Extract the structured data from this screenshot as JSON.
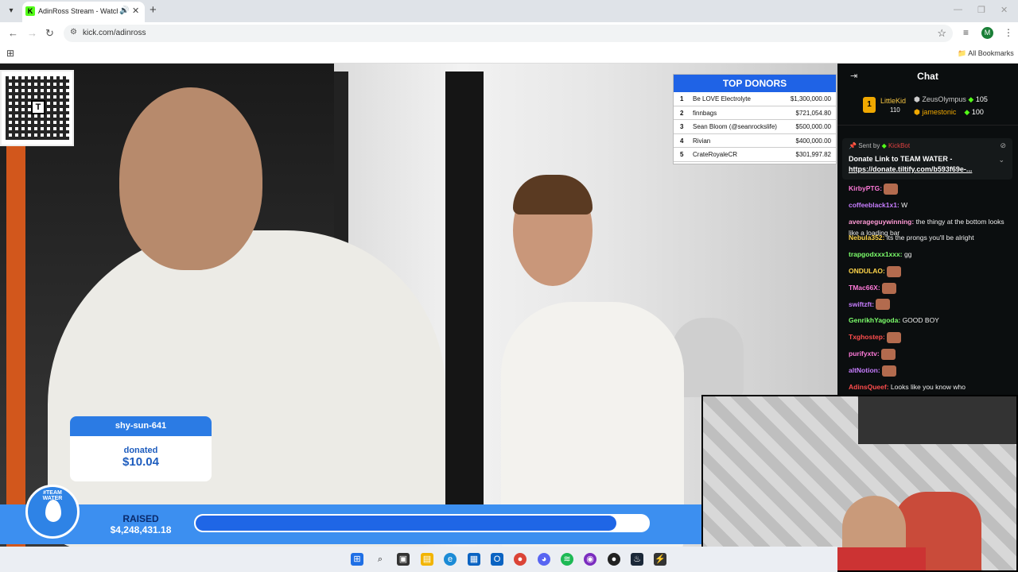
{
  "browser": {
    "tab_title": "AdinRoss Stream - Watch Live",
    "url": "kick.com/adinross",
    "all_bookmarks": "All Bookmarks",
    "profile_initial": "M"
  },
  "stream": {
    "qr_center": "T",
    "top_donors": {
      "title": "TOP DONORS",
      "rows": [
        {
          "rank": "1",
          "name": "Be LOVE Electrolyte",
          "amount": "$1,300,000.00"
        },
        {
          "rank": "2",
          "name": "finnbags",
          "amount": "$721,054.80"
        },
        {
          "rank": "3",
          "name": "Sean Bloom (@seanrockslife)",
          "amount": "$500,000.00"
        },
        {
          "rank": "4",
          "name": "Rivian",
          "amount": "$400,000.00"
        },
        {
          "rank": "5",
          "name": "CrateRoyaleCR",
          "amount": "$301,997.82"
        }
      ]
    },
    "alert": {
      "username": "shy-sun-641",
      "label": "donated",
      "amount": "$10.04"
    },
    "raised": {
      "label": "RAISED",
      "amount": "$4,248,431.18",
      "progress_fraction": 0.93
    },
    "logo_text": "#TEAM WATER"
  },
  "chat": {
    "title": "Chat",
    "leaderboard": {
      "first": {
        "rank": "1",
        "name": "LittleKid",
        "count": "110"
      },
      "second": {
        "name": "ZeusOlympus",
        "count": "105"
      },
      "third": {
        "name": "jamestonic",
        "count": "100"
      }
    },
    "pinned": {
      "sent_by": "Sent by",
      "sender": "KickBot",
      "title": "Donate Link to TEAM WATER -",
      "link": "https://donate.tiltify.com/b593f69e-..."
    },
    "messages": [
      {
        "user": "KirbyPTG:",
        "text": "",
        "color": "#ff7ad9",
        "emote": true
      },
      {
        "user": "coffeeblack1x1:",
        "text": "W",
        "color": "#c77dff",
        "emote": false
      },
      {
        "user": "averageguywinning:",
        "text": "the thingy at the bottom looks like a loading bar",
        "color": "#ff9ad5",
        "emote": false
      },
      {
        "user": "Nebula352:",
        "text": "its the prongs you'll be alright",
        "color": "#ffd54a",
        "emote": false
      },
      {
        "user": "trapgodxxx1xxx:",
        "text": "gg",
        "color": "#7cff6b",
        "emote": false
      },
      {
        "user": "ONDULAO:",
        "text": "",
        "color": "#ffd54a",
        "emote": true
      },
      {
        "user": "TMac66X:",
        "text": "",
        "color": "#ff7ad9",
        "emote": true
      },
      {
        "user": "swiftzft:",
        "text": "",
        "color": "#c77dff",
        "emote": true
      },
      {
        "user": "GenrikhYagoda:",
        "text": "GOOD BOY",
        "color": "#7cff6b",
        "emote": false
      },
      {
        "user": "Txghostep:",
        "text": "",
        "color": "#ff4d4d",
        "emote": true
      },
      {
        "user": "purifyxtv:",
        "text": "",
        "color": "#ff7ad9",
        "emote": true
      },
      {
        "user": "altNotion:",
        "text": "",
        "color": "#c77dff",
        "emote": true
      },
      {
        "user": "AdinsQueef:",
        "text": "Looks like you know who",
        "color": "#ff4d4d",
        "emote": false
      }
    ]
  },
  "colors": {
    "kick_green": "#53fc18",
    "donor_blue": "#1f63e6",
    "raised_blue": "#3c8ff0"
  }
}
